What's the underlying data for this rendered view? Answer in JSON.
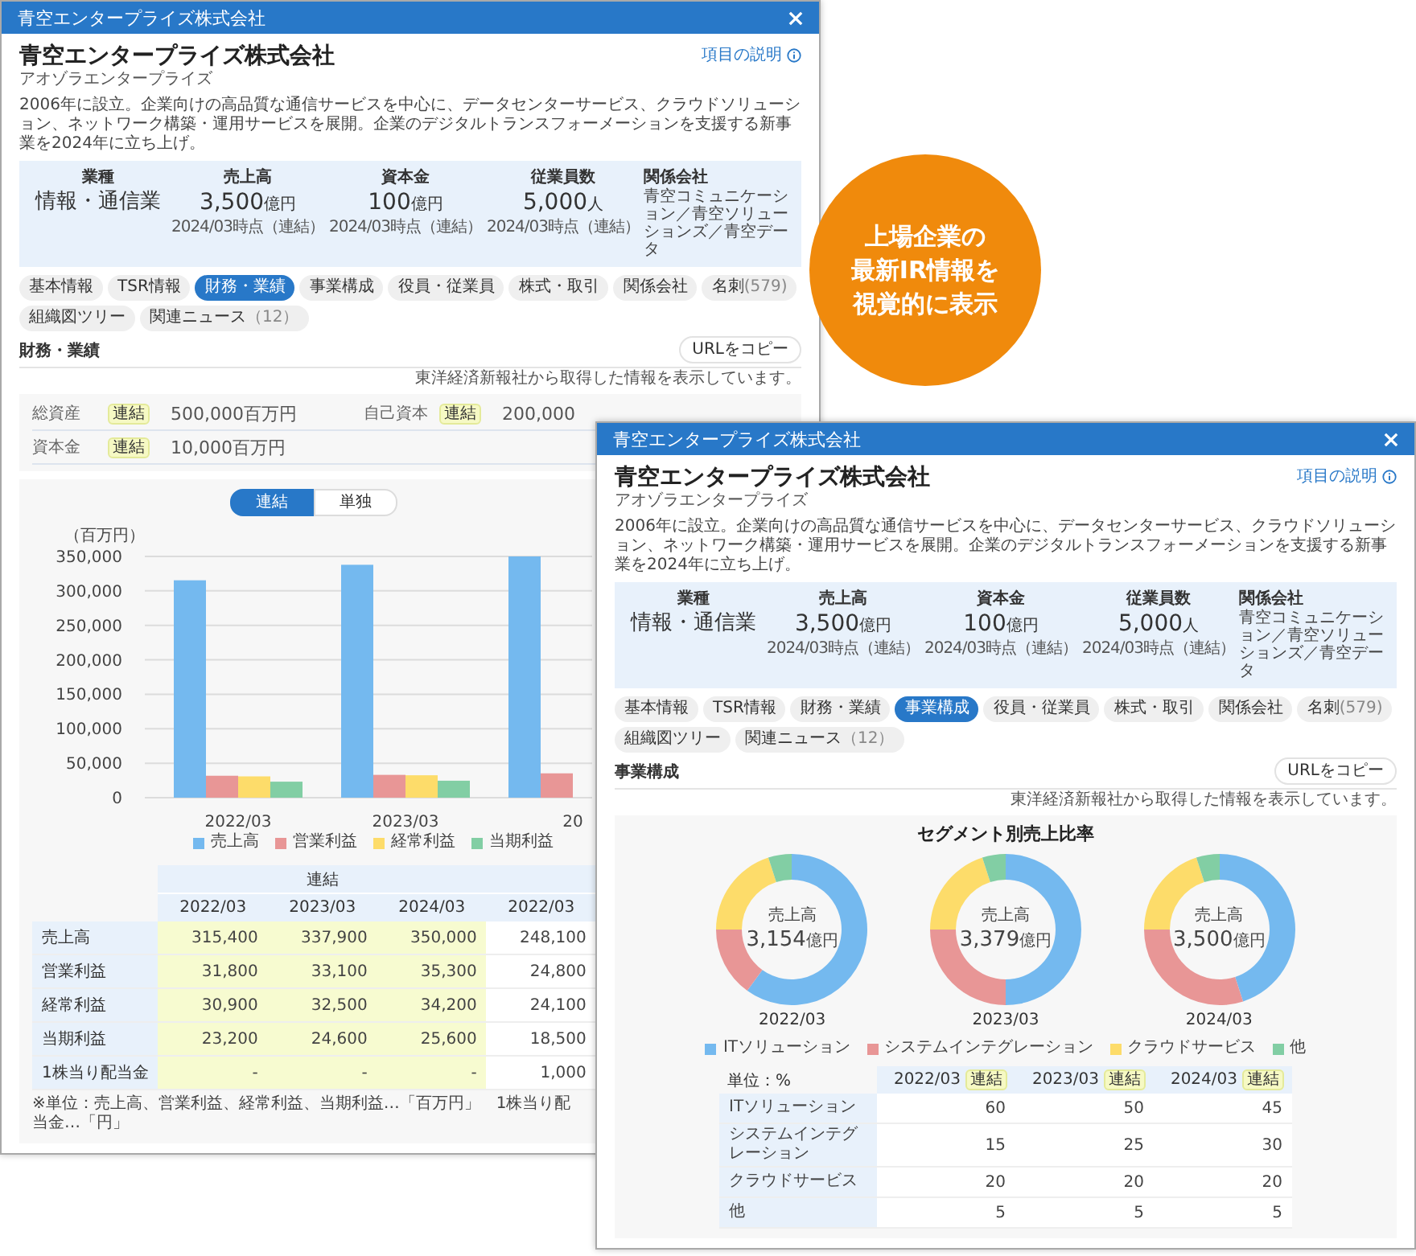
{
  "badge": {
    "lines": [
      "上場企業の",
      "最新IR情報を",
      "視覚的に表示"
    ]
  },
  "windows": [
    {
      "kind": "financials",
      "title": "青空エンタープライズ株式会社",
      "company": {
        "name": "青空エンタープライズ株式会社",
        "kana": "アオゾラエンタープライズ"
      },
      "help_link": "項目の説明",
      "description": "2006年に設立。企業向けの高品質な通信サービスを中心に、データセンターサービス、クラウドソリューション、ネットワーク構築・運用サービスを展開。企業のデジタルトランスフォーメーションを支援する新事業を2024年に立ち上げ。",
      "summary": [
        {
          "kind": "text",
          "label": "業種",
          "value": "情報・通信業"
        },
        {
          "kind": "figure",
          "label": "売上高",
          "value": "3,500",
          "unit": "億円",
          "note": "2024/03時点（連結）"
        },
        {
          "kind": "figure",
          "label": "資本金",
          "value": "100",
          "unit": "億円",
          "note": "2024/03時点（連結）"
        },
        {
          "kind": "figure",
          "label": "従業員数",
          "value": "5,000",
          "unit": "人",
          "note": "2024/03時点（連結）"
        },
        {
          "kind": "list",
          "label": "関係会社",
          "value": "青空コミュニケーション／青空ソリューションズ／青空データ"
        }
      ],
      "tabs": [
        {
          "label": "基本情報",
          "selected": false
        },
        {
          "label": "TSR情報",
          "selected": false
        },
        {
          "label": "財務・業績",
          "selected": true
        },
        {
          "label": "事業構成",
          "selected": false
        },
        {
          "label": "役員・従業員",
          "selected": false
        },
        {
          "label": "株式・取引",
          "selected": false
        },
        {
          "label": "関係会社",
          "selected": false
        },
        {
          "label": "名刺",
          "count": "(579)",
          "selected": false
        },
        {
          "label": "組織図ツリー",
          "selected": false
        },
        {
          "label": "関連ニュース",
          "count": "（12）",
          "selected": false
        }
      ],
      "section": {
        "title": "財務・業績",
        "copy_button": "URLをコピー",
        "source_note": "東洋経済新報社から取得した情報を表示しています。"
      },
      "financials": {
        "rows": [
          [
            {
              "label": "総資産",
              "badge": "連結",
              "value": "500,000百万円"
            },
            {
              "label": "自己資本",
              "badge": "連結",
              "value": "200,000"
            }
          ],
          [
            {
              "label": "資本金",
              "badge": "連結",
              "value": "10,000百万円"
            }
          ]
        ]
      },
      "chart": {
        "toggle": [
          {
            "label": "連結",
            "selected": true
          },
          {
            "label": "単独",
            "selected": false
          }
        ],
        "unit_label": "（百万円）",
        "chart_data": {
          "type": "bar",
          "grid": true,
          "legend": true,
          "categories": [
            "2022/03",
            "2023/03",
            "20"
          ],
          "ylim": [
            0,
            350000
          ],
          "yticks": [
            {
              "value": 0,
              "label": "0"
            },
            {
              "value": 50000,
              "label": "50,000"
            },
            {
              "value": 100000,
              "label": "100,000"
            },
            {
              "value": 150000,
              "label": "150,000"
            },
            {
              "value": 200000,
              "label": "200,000"
            },
            {
              "value": 250000,
              "label": "250,000"
            },
            {
              "value": 300000,
              "label": "300,000"
            },
            {
              "value": 350000,
              "label": "350,000"
            }
          ],
          "series": [
            {
              "name": "売上高",
              "color": "#74b9ef",
              "values": [
                315400,
                337900,
                350000
              ]
            },
            {
              "name": "営業利益",
              "color": "#e89696",
              "values": [
                31800,
                33100,
                35300
              ]
            },
            {
              "name": "経常利益",
              "color": "#fddc6a",
              "values": [
                30900,
                32500,
                null
              ]
            },
            {
              "name": "当期利益",
              "color": "#82cea4",
              "values": [
                23200,
                24600,
                null
              ]
            }
          ]
        }
      },
      "table": {
        "group_header": "連結",
        "columns": [
          {
            "label": "2022/03",
            "consolidated": true
          },
          {
            "label": "2023/03",
            "consolidated": true
          },
          {
            "label": "2024/03",
            "consolidated": true
          },
          {
            "label": "2022/03",
            "consolidated": false
          }
        ],
        "rows": [
          {
            "label": "売上高",
            "values": [
              "315,400",
              "337,900",
              "350,000",
              "248,100"
            ]
          },
          {
            "label": "営業利益",
            "values": [
              "31,800",
              "33,100",
              "35,300",
              "24,800"
            ]
          },
          {
            "label": "経常利益",
            "values": [
              "30,900",
              "32,500",
              "34,200",
              "24,100"
            ]
          },
          {
            "label": "当期利益",
            "values": [
              "23,200",
              "24,600",
              "25,600",
              "18,500"
            ]
          },
          {
            "label": "1株当り配当金",
            "values": [
              "-",
              "-",
              "-",
              "1,000"
            ]
          }
        ],
        "footnote": "※単位：売上高、営業利益、経常利益、当期利益…「百万円」　1株当り配当金…「円」"
      }
    },
    {
      "kind": "segments",
      "title": "青空エンタープライズ株式会社",
      "company": {
        "name": "青空エンタープライズ株式会社",
        "kana": "アオゾラエンタープライズ"
      },
      "help_link": "項目の説明",
      "description": "2006年に設立。企業向けの高品質な通信サービスを中心に、データセンターサービス、クラウドソリューション、ネットワーク構築・運用サービスを展開。企業のデジタルトランスフォーメーションを支援する新事業を2024年に立ち上げ。",
      "summary": [
        {
          "kind": "text",
          "label": "業種",
          "value": "情報・通信業"
        },
        {
          "kind": "figure",
          "label": "売上高",
          "value": "3,500",
          "unit": "億円",
          "note": "2024/03時点（連結）"
        },
        {
          "kind": "figure",
          "label": "資本金",
          "value": "100",
          "unit": "億円",
          "note": "2024/03時点（連結）"
        },
        {
          "kind": "figure",
          "label": "従業員数",
          "value": "5,000",
          "unit": "人",
          "note": "2024/03時点（連結）"
        },
        {
          "kind": "list",
          "label": "関係会社",
          "value": "青空コミュニケーション／青空ソリューションズ／青空データ"
        }
      ],
      "tabs": [
        {
          "label": "基本情報",
          "selected": false
        },
        {
          "label": "TSR情報",
          "selected": false
        },
        {
          "label": "財務・業績",
          "selected": false
        },
        {
          "label": "事業構成",
          "selected": true
        },
        {
          "label": "役員・従業員",
          "selected": false
        },
        {
          "label": "株式・取引",
          "selected": false
        },
        {
          "label": "関係会社",
          "selected": false
        },
        {
          "label": "名刺",
          "count": "(579)",
          "selected": false
        },
        {
          "label": "組織図ツリー",
          "selected": false
        },
        {
          "label": "関連ニュース",
          "count": "（12）",
          "selected": false
        }
      ],
      "section": {
        "title": "事業構成",
        "copy_button": "URLをコピー",
        "source_note": "東洋経済新報社から取得した情報を表示しています。"
      },
      "segments": {
        "title": "セグメント別売上比率",
        "donuts": [
          {
            "center_label": "売上高",
            "value": "3,154",
            "unit": "億円",
            "year": "2022/03",
            "chart_data": {
              "type": "donut",
              "series": [
                {
                  "values": [
                    60,
                    15,
                    20,
                    5
                  ]
                }
              ]
            }
          },
          {
            "center_label": "売上高",
            "value": "3,379",
            "unit": "億円",
            "year": "2023/03",
            "chart_data": {
              "type": "donut",
              "series": [
                {
                  "values": [
                    50,
                    25,
                    20,
                    5
                  ]
                }
              ]
            }
          },
          {
            "center_label": "売上高",
            "value": "3,500",
            "unit": "億円",
            "year": "2024/03",
            "chart_data": {
              "type": "donut",
              "series": [
                {
                  "values": [
                    45,
                    30,
                    20,
                    5
                  ]
                }
              ]
            }
          }
        ],
        "legend": [
          {
            "label": "ITソリューション",
            "color": "#74b9ef"
          },
          {
            "label": "システムインテグレーション",
            "color": "#e89696"
          },
          {
            "label": "クラウドサービス",
            "color": "#fddc6a"
          },
          {
            "label": "他",
            "color": "#82cea4"
          }
        ],
        "table": {
          "unit_label": "単位：%",
          "columns": [
            {
              "label": "2022/03",
              "badge": "連結"
            },
            {
              "label": "2023/03",
              "badge": "連結"
            },
            {
              "label": "2024/03",
              "badge": "連結"
            }
          ],
          "rows": [
            {
              "label": "ITソリューション",
              "values": [
                "60",
                "50",
                "45"
              ]
            },
            {
              "label": "システムインテグレーション",
              "values": [
                "15",
                "25",
                "30"
              ]
            },
            {
              "label": "クラウドサービス",
              "values": [
                "20",
                "20",
                "20"
              ]
            },
            {
              "label": "他",
              "values": [
                "5",
                "5",
                "5"
              ]
            }
          ]
        }
      }
    }
  ]
}
